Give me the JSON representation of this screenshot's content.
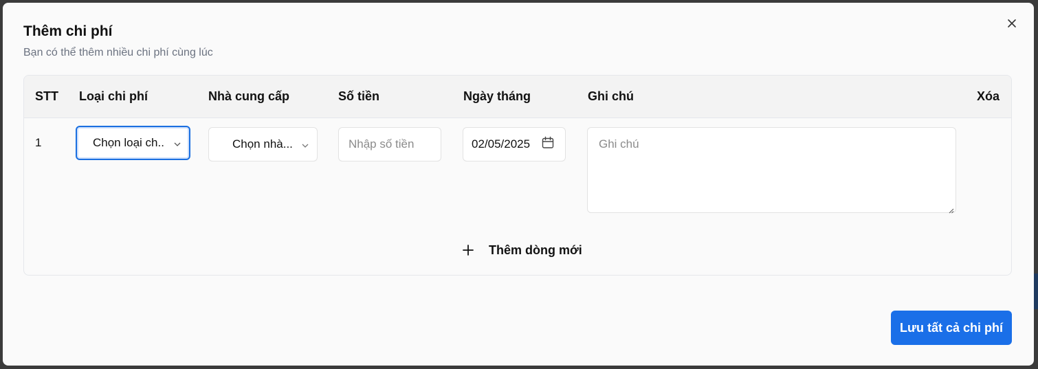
{
  "dialog": {
    "title": "Thêm chi phí",
    "subtitle": "Bạn có thể thêm nhiều chi phí cùng lúc",
    "close_icon": "close-icon"
  },
  "table": {
    "headers": {
      "stt": "STT",
      "type": "Loại chi phí",
      "supplier": "Nhà cung cấp",
      "amount": "Số tiền",
      "date": "Ngày tháng",
      "note": "Ghi chú",
      "delete": "Xóa"
    },
    "rows": [
      {
        "stt": "1",
        "type_selected": "Chọn loại ch..",
        "supplier_selected": "Chọn nhà...",
        "amount_placeholder": "Nhập số tiền",
        "date_value": "02/05/2025",
        "note_placeholder": "Ghi chú"
      }
    ],
    "add_row_label": "Thêm dòng mới"
  },
  "footer": {
    "save_label": "Lưu tất cả chi phí",
    "accent_color": "#1a6fe8"
  },
  "icons": {
    "type_dropdown": "chevron-down-icon",
    "supplier_dropdown": "chevron-down-icon",
    "date_picker": "calendar-icon",
    "add_row": "plus-icon",
    "textarea_resize": "resize-grip-icon"
  }
}
